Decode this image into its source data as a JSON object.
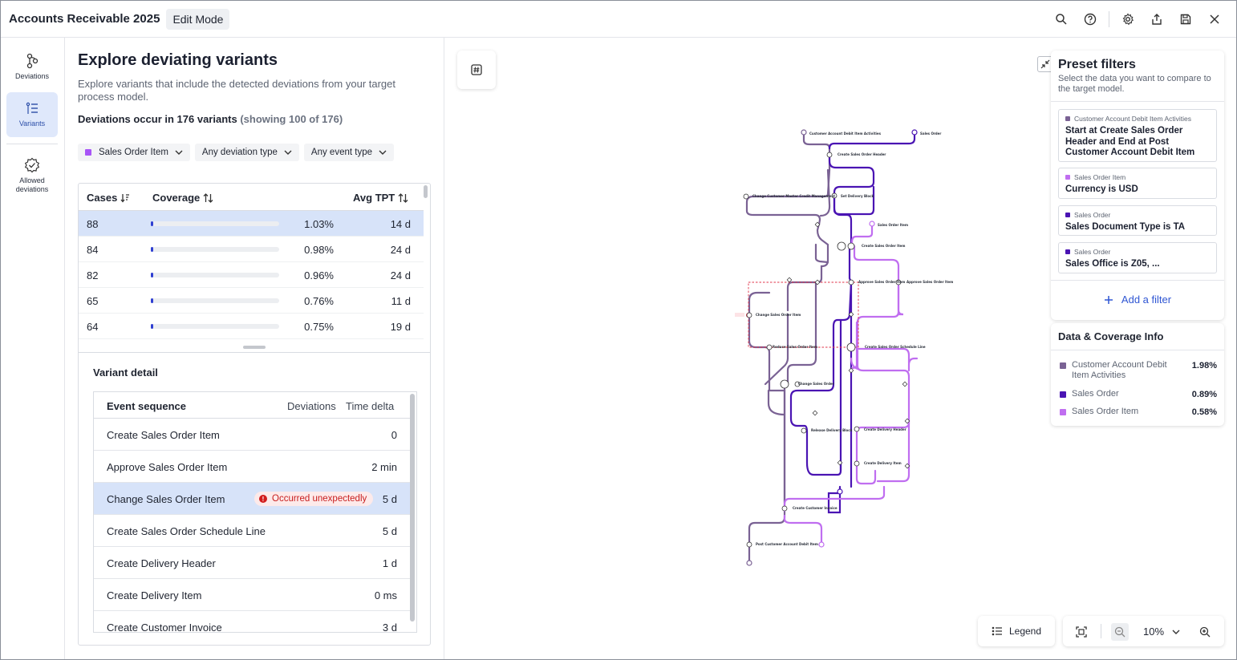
{
  "app": {
    "title": "Accounts Receivable 2025",
    "mode": "Edit Mode"
  },
  "topbar": {
    "icons": [
      "search-icon",
      "help-icon",
      "settings-icon",
      "share-icon",
      "save-icon",
      "close-icon"
    ]
  },
  "rail": {
    "items": [
      {
        "label": "Deviations",
        "icon": "deviations-icon",
        "active": false
      },
      {
        "label": "Variants",
        "icon": "variants-icon",
        "active": true
      },
      {
        "label": "Allowed deviations",
        "icon": "allowed-deviations-icon",
        "active": false
      }
    ]
  },
  "panel": {
    "title": "Explore deviating variants",
    "description": "Explore variants that include the detected deviations from your target process model.",
    "summary": "Deviations occur in 176 variants",
    "summary_muted": "(showing 100 of 176)",
    "filters": [
      {
        "label": "Sales Order Item",
        "color": "#a855f7"
      },
      {
        "label": "Any deviation type"
      },
      {
        "label": "Any event type"
      }
    ],
    "table": {
      "headers": {
        "cases": "Cases",
        "coverage": "Coverage",
        "tpt": "Avg TPT"
      },
      "rows": [
        {
          "cases": "88",
          "coverage": "1.03%",
          "coverage_value": 1.03,
          "tpt": "14 d"
        },
        {
          "cases": "84",
          "coverage": "0.98%",
          "coverage_value": 0.98,
          "tpt": "24 d"
        },
        {
          "cases": "82",
          "coverage": "0.96%",
          "coverage_value": 0.96,
          "tpt": "24 d"
        },
        {
          "cases": "65",
          "coverage": "0.76%",
          "coverage_value": 0.76,
          "tpt": "11 d"
        },
        {
          "cases": "64",
          "coverage": "0.75%",
          "coverage_value": 0.75,
          "tpt": "19 d"
        }
      ]
    },
    "detail": {
      "title": "Variant detail",
      "headers": {
        "event": "Event sequence",
        "deviations": "Deviations",
        "delta": "Time delta"
      },
      "rows": [
        {
          "name": "Create Sales Order Item",
          "delta": "0"
        },
        {
          "name": "Approve Sales Order Item",
          "delta": "2 min"
        },
        {
          "name": "Change Sales Order Item",
          "delta": "5 d",
          "badge": "Occurred unexpectedly"
        },
        {
          "name": "Create Sales Order Schedule Line",
          "delta": "5 d"
        },
        {
          "name": "Create Delivery Header",
          "delta": "1 d"
        },
        {
          "name": "Create Delivery Item",
          "delta": "0 ms"
        },
        {
          "name": "Create Customer Invoice",
          "delta": "3 d"
        }
      ]
    }
  },
  "graph": {
    "colors": {
      "customer": "#7a6294",
      "sales_order": "#4a14b3",
      "item": "#c06ef0",
      "deviation": "#e0344a"
    },
    "labels": {
      "start_customer": "Customer Account Debit Item Activities",
      "start_sales_order": "Sales Order",
      "start_item": "Sales Order Item",
      "n1": "Create Sales Order Header",
      "n2": "Change Customer Master Credit Management",
      "n3": "Set Delivery Block",
      "n4": "Create Sales Order Item",
      "n5": "Approve Sales Order Item",
      "n5b": "Approve Sales Order Item",
      "n6": "Change Sales Order Item",
      "n7": "Reduce Sales Order Item",
      "n8": "Create Sales Order Schedule Line",
      "n9": "Change Sales Order",
      "n10": "Release Delivery Block",
      "n11": "Create Delivery Header",
      "n12": "Create Delivery Item",
      "n13": "Create Customer Invoice",
      "n14": "Post Customer Account Debit Item"
    }
  },
  "preset": {
    "title": "Preset filters",
    "subtitle": "Select the data you want to compare to the target model.",
    "cards": [
      {
        "label": "Customer Account Debit Item Activities",
        "color": "#7a6294",
        "text": "Start at Create Sales Order Header and End at Post Customer Account Debit Item"
      },
      {
        "label": "Sales Order Item",
        "color": "#c06ef0",
        "text": "Currency is USD"
      },
      {
        "label": "Sales Order",
        "color": "#4a14b3",
        "text": "Sales Document Type is TA"
      },
      {
        "label": "Sales Order",
        "color": "#4a14b3",
        "text": "Sales Office is Z05, ..."
      }
    ],
    "add_filter": "Add a filter"
  },
  "coverage": {
    "title": "Data & Coverage Info",
    "items": [
      {
        "name": "Customer Account Debit Item Activities",
        "value": "1.98%",
        "color": "#7a6294"
      },
      {
        "name": "Sales Order",
        "value": "0.89%",
        "color": "#4a14b3"
      },
      {
        "name": "Sales Order Item",
        "value": "0.58%",
        "color": "#c06ef0"
      }
    ]
  },
  "controls": {
    "legend": "Legend",
    "zoom": "10%"
  }
}
